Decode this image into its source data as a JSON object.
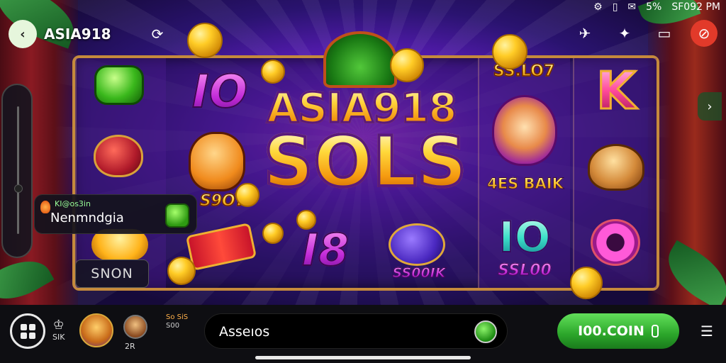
{
  "status_bar": {
    "icon_1": "⚙",
    "icon_2": "▯",
    "icon_3": "✉",
    "battery": "5%",
    "time": "SF092 PM"
  },
  "header": {
    "back_label": "‹",
    "app_title": "ASIA918",
    "refresh_icon": "⟳"
  },
  "top_icons": [
    {
      "name": "pin-icon",
      "glyph": "✈"
    },
    {
      "name": "shop-icon",
      "glyph": "✦"
    },
    {
      "name": "chat-icon",
      "glyph": "▭"
    },
    {
      "name": "search-icon",
      "glyph": "⊘"
    }
  ],
  "game": {
    "logo_line1": "ASIA918",
    "logo_line2": "SOLS",
    "symbols": {
      "io": "IO",
      "io_prize": "S9OYI",
      "eighteen": "I8",
      "pot_prize": "SS00IK",
      "banner_top": "SS.LO7",
      "bear_prize": "4ES BAIK",
      "ten": "IO",
      "ten_prize": "SSL00",
      "k": "K"
    },
    "spin_label": "SNON"
  },
  "popup": {
    "small_text": "KI@os3in",
    "main_text": "Nenmndgia"
  },
  "bottom_bar": {
    "mini_label_1": "SIK",
    "mini_label_2": "2R",
    "badge_top": "So SiS",
    "badge_bottom": "S00",
    "search_text": "Asseıos",
    "coin_button": "I00.COIN"
  },
  "colors": {
    "accent_green": "#2ba52a",
    "gold": "#ffcb2f",
    "magenta": "#c22ad8",
    "danger": "#e23a2a"
  }
}
